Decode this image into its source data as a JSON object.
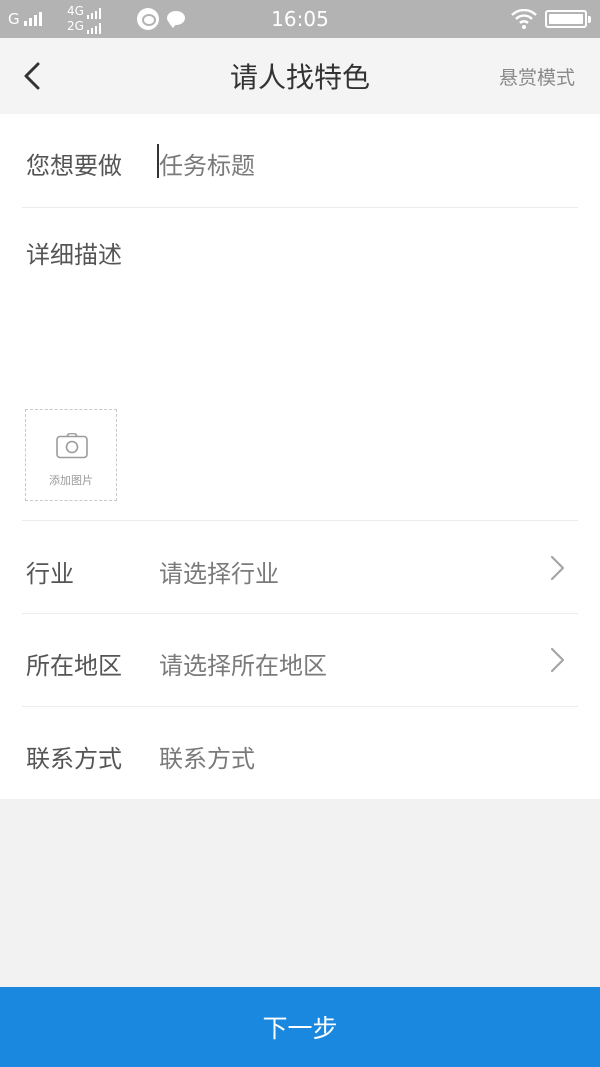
{
  "status_bar": {
    "carrier": "G",
    "network_top": "4G",
    "network_bottom": "2G",
    "time": "16:05"
  },
  "nav": {
    "title": "请人找特色",
    "right_action": "悬赏模式"
  },
  "form": {
    "task_label": "您想要做",
    "task_placeholder": "任务标题",
    "detail_label": "详细描述",
    "add_photo_label": "添加图片",
    "industry_label": "行业",
    "industry_value": "请选择行业",
    "region_label": "所在地区",
    "region_value": "请选择所在地区",
    "contact_label": "联系方式",
    "contact_value": "联系方式"
  },
  "footer": {
    "next_label": "下一步"
  },
  "colors": {
    "primary": "#1b88e0",
    "status_bar": "#b3b3b3",
    "nav_background": "#f4f4f4"
  },
  "icons": [
    "back-arrow-icon",
    "camera-icon",
    "chevron-right-icon",
    "wifi-icon",
    "battery-icon",
    "message-icon"
  ]
}
